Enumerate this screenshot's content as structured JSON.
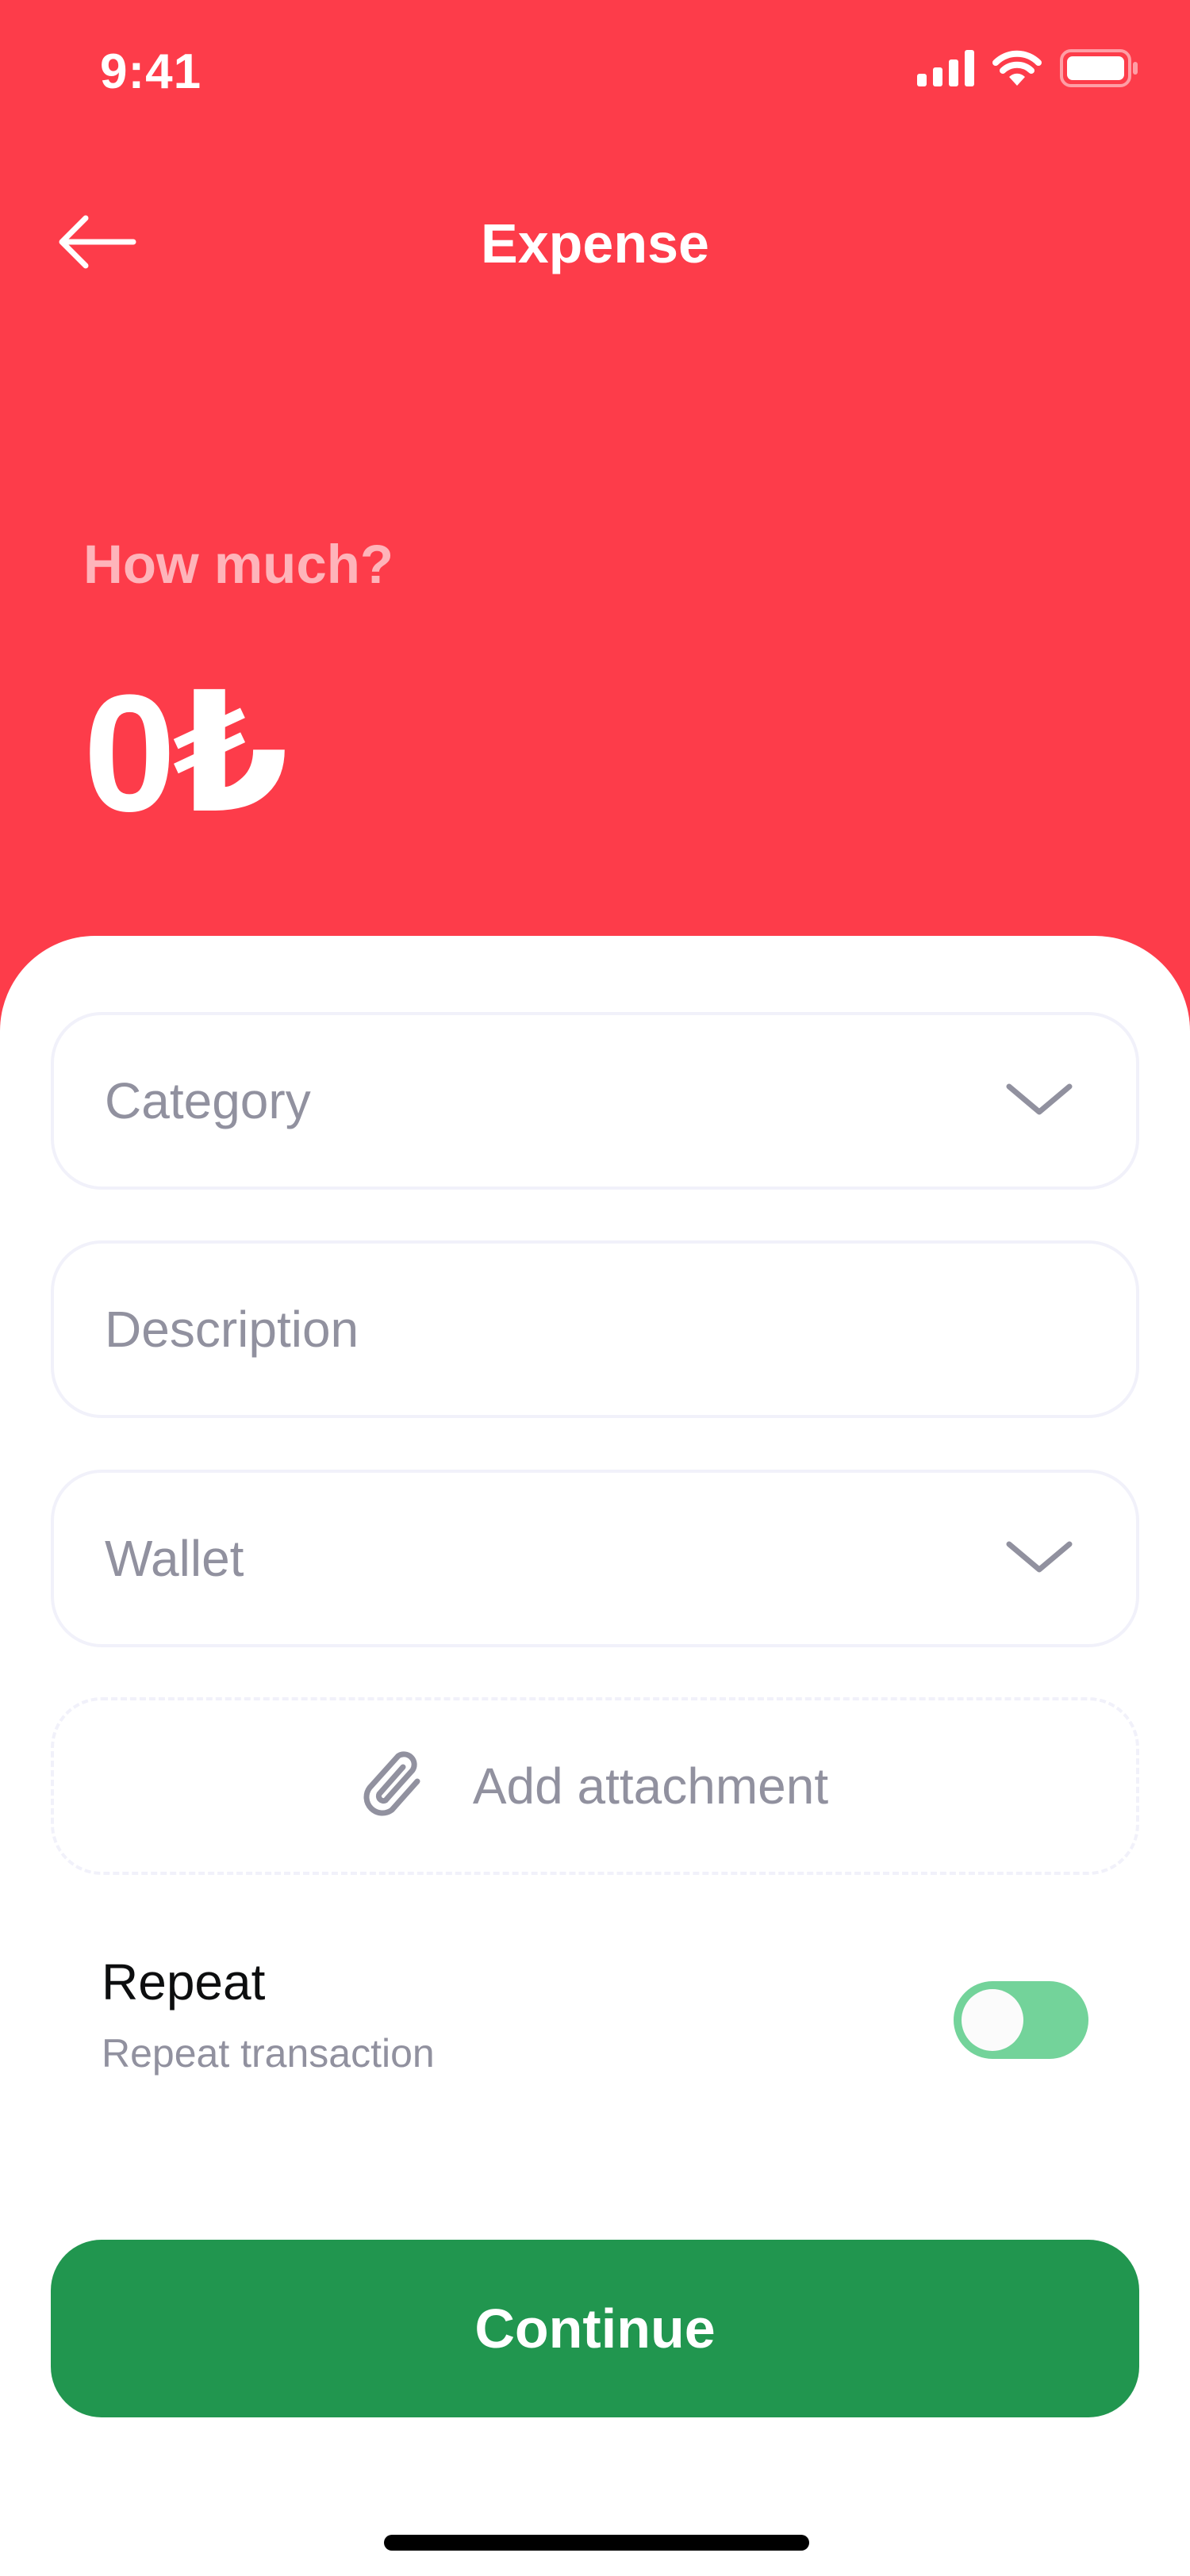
{
  "status_bar": {
    "time": "9:41",
    "icons": [
      "cellular-signal-icon",
      "wifi-icon",
      "battery-icon"
    ]
  },
  "header": {
    "back_icon": "arrow-left-icon",
    "title": "Expense"
  },
  "amount": {
    "label": "How much?",
    "value": "0₺"
  },
  "form": {
    "category": {
      "placeholder": "Category",
      "icon": "chevron-down-icon"
    },
    "description": {
      "placeholder": "Description"
    },
    "wallet": {
      "placeholder": "Wallet",
      "icon": "chevron-down-icon"
    },
    "attachment": {
      "label": "Add attachment",
      "icon": "paperclip-icon"
    },
    "repeat": {
      "title": "Repeat",
      "subtitle": "Repeat transaction",
      "toggle_on": true
    },
    "continue_label": "Continue"
  },
  "colors": {
    "header_bg": "#FD3C4A",
    "primary_button": "#21964F",
    "toggle_on": "#73D39A",
    "placeholder_text": "#91919F",
    "field_border": "#F1F1FA"
  }
}
